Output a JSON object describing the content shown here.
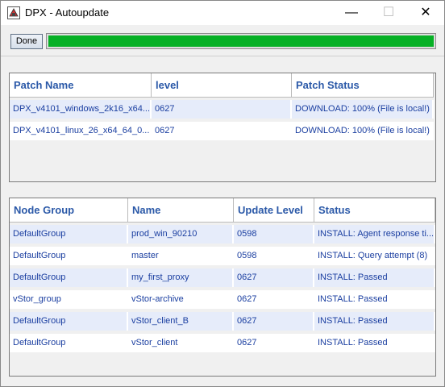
{
  "window": {
    "title": "DPX - Autoupdate",
    "minimize_glyph": "—",
    "maximize_glyph": "☐",
    "close_glyph": "✕"
  },
  "toolbar": {
    "done_label": "Done",
    "progress_fraction": 1.0,
    "progress_color": "#06b025"
  },
  "patch_table": {
    "headers": [
      "Patch Name",
      "level",
      "Patch Status"
    ],
    "rows": [
      [
        "DPX_v4101_windows_2k16_x64...",
        "0627",
        "DOWNLOAD: 100% (File is local!)"
      ],
      [
        "DPX_v4101_linux_26_x64_64_0...",
        "0627",
        "DOWNLOAD: 100% (File is local!)"
      ]
    ]
  },
  "node_table": {
    "headers": [
      "Node Group",
      "Name",
      "Update Level",
      "Status"
    ],
    "rows": [
      [
        "DefaultGroup",
        "prod_win_90210",
        "0598",
        "INSTALL: Agent response ti..."
      ],
      [
        "DefaultGroup",
        "master",
        "0598",
        "INSTALL: Query attempt (8)"
      ],
      [
        "DefaultGroup",
        "my_first_proxy",
        "0627",
        "INSTALL: Passed"
      ],
      [
        "vStor_group",
        "vStor-archive",
        "0627",
        "INSTALL: Passed"
      ],
      [
        "DefaultGroup",
        "vStor_client_B",
        "0627",
        "INSTALL: Passed"
      ],
      [
        "DefaultGroup",
        "vStor_client",
        "0627",
        "INSTALL: Passed"
      ]
    ]
  }
}
